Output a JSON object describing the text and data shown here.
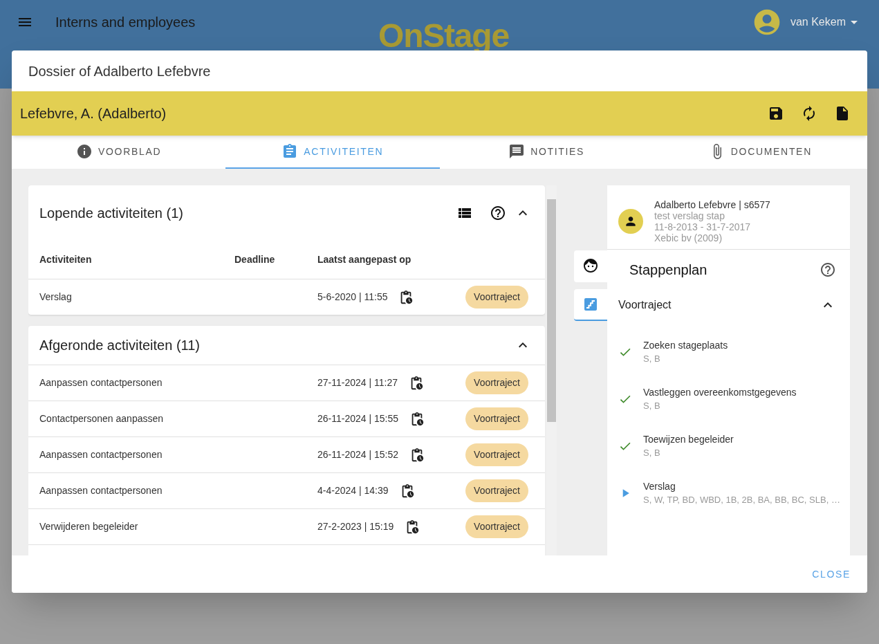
{
  "app_bar": {
    "title": "Interns and employees",
    "logo": "OnStage",
    "user": "van Kekem"
  },
  "dialog": {
    "title": "Dossier of Adalberto Lefebvre",
    "close": "CLOSE"
  },
  "person_bar": {
    "name": "Lefebvre, A. (Adalberto)"
  },
  "tabs": [
    {
      "label": "VOORBLAD",
      "selected": false
    },
    {
      "label": "ACTIVITEITEN",
      "selected": true
    },
    {
      "label": "NOTITIES",
      "selected": false
    },
    {
      "label": "DOCUMENTEN",
      "selected": false
    }
  ],
  "running": {
    "title": "Lopende activiteiten (1)",
    "expanded": true,
    "columns": [
      "Activiteiten",
      "Deadline",
      "Laatst aangepast op"
    ],
    "rows": [
      {
        "activity": "Verslag",
        "deadline": "",
        "modified": "5-6-2020 | 11:55",
        "phase": "Voortraject"
      }
    ]
  },
  "finished": {
    "title": "Afgeronde activiteiten (11)",
    "expanded": true,
    "rows": [
      {
        "activity": "Aanpassen contactpersonen",
        "modified": "27-11-2024 | 11:27",
        "phase": "Voortraject"
      },
      {
        "activity": "Contactpersonen aanpassen",
        "modified": "26-11-2024 | 15:55",
        "phase": "Voortraject"
      },
      {
        "activity": "Aanpassen contactpersonen",
        "modified": "26-11-2024 | 15:52",
        "phase": "Voortraject"
      },
      {
        "activity": "Aanpassen contactpersonen",
        "modified": "4-4-2024 | 14:39",
        "phase": "Voortraject"
      },
      {
        "activity": "Verwijderen begeleider",
        "modified": "27-2-2023 | 15:19",
        "phase": "Voortraject"
      }
    ]
  },
  "profile": {
    "name": "Adalberto Lefebvre | s6577",
    "lines": [
      "test verslag stap",
      "11-8-2013 - 31-7-2017",
      "Xebic bv (2009)"
    ]
  },
  "side_tabs": [
    {
      "kind": "face",
      "selected": false
    },
    {
      "kind": "stairs",
      "selected": true
    }
  ],
  "plan": {
    "title": "Stappenplan",
    "phase": "Voortraject",
    "expanded": true,
    "steps": [
      {
        "kind": "done",
        "name": "Zoeken stageplaats",
        "roles": "S, B"
      },
      {
        "kind": "done",
        "name": "Vastleggen overeenkomstgegevens",
        "roles": "S, B"
      },
      {
        "kind": "done",
        "name": "Toewijzen begeleider",
        "roles": "S, B"
      },
      {
        "kind": "current",
        "name": "Verslag",
        "roles": "S, W, TP, BD, WBD, 1B, 2B, BA, BB, BC, SLB, …"
      }
    ]
  }
}
